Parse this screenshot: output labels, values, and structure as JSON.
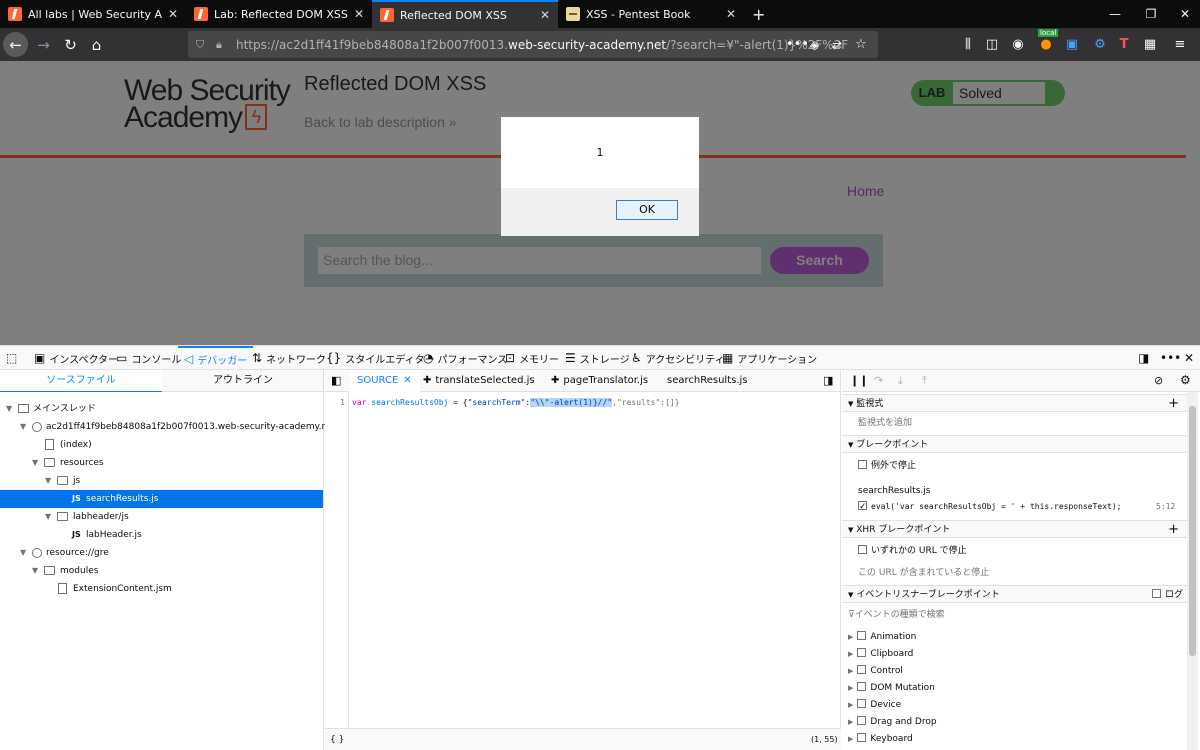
{
  "browser": {
    "tabs": [
      {
        "title": "All labs | Web Security Academ"
      },
      {
        "title": "Lab: Reflected DOM XSS | Web"
      },
      {
        "title": "Reflected DOM XSS"
      },
      {
        "title": "XSS - Pentest Book"
      }
    ],
    "new_tab": "+",
    "url_prefix": "https://ac2d1ff41f9beb84808a1f2b007f0013.",
    "url_domain": "web-security-academy.net",
    "url_suffix": "/?search=¥\"-alert(1)}%2F%2F",
    "local_badge": "local"
  },
  "page": {
    "logo_line1": "Web Security",
    "logo_line2": "Academy",
    "lab_title": "Reflected DOM XSS",
    "back_link": "Back to lab description »",
    "lab_badge": "LAB",
    "lab_status": "Solved",
    "home_link": "Home",
    "search_placeholder": "Search the blog...",
    "search_button": "Search"
  },
  "alert": {
    "message": "1",
    "ok": "OK"
  },
  "devtools": {
    "tabs": [
      "インスペクター",
      "コンソール",
      "デバッガー",
      "ネットワーク",
      "スタイルエディター",
      "パフォーマンス",
      "メモリー",
      "ストレージ",
      "アクセシビリティ",
      "アプリケーション"
    ],
    "left_tabs": [
      "ソースファイル",
      "アウトライン"
    ],
    "tree": [
      "メインスレッド",
      "ac2d1ff41f9beb84808a1f2b007f0013.web-security-academy.net",
      "(index)",
      "resources",
      "js",
      "searchResults.js",
      "labheader/js",
      "labHeader.js",
      "resource://gre",
      "modules",
      "ExtensionContent.jsm"
    ],
    "editor_tabs": [
      "SOURCE",
      "translateSelected.js",
      "pageTranslator.js",
      "searchResults.js"
    ],
    "line_number": "1",
    "code": {
      "kw": "var",
      "name": "searchResultsObj",
      "eq": " = {",
      "key": "\"searchTerm\"",
      "colon": ":",
      "hl": "\"\\\\\"-alert(1)}//\"",
      "rest": ",\"results\":[]}"
    },
    "footer_left": "{ }",
    "cursor_pos": "(1, 55)",
    "right": {
      "watch": "監視式",
      "watch_add": "監視式を追加",
      "breakpoints": "ブレークポイント",
      "pause_exceptions": "例外で停止",
      "bp_file": "searchResults.js",
      "bp_code": "eval('var searchResultsObj = ' + this.responseText);",
      "bp_line": "5:12",
      "xhr": "XHR ブレークポイント",
      "xhr_any": "いずれかの URL で停止",
      "xhr_contains": "この URL が含まれていると停止",
      "event_bp": "イベントリスナーブレークポイント",
      "log": "ログ",
      "event_filter": "イベントの種類で検索",
      "events": [
        "Animation",
        "Clipboard",
        "Control",
        "DOM Mutation",
        "Device",
        "Drag and Drop",
        "Keyboard"
      ]
    }
  }
}
